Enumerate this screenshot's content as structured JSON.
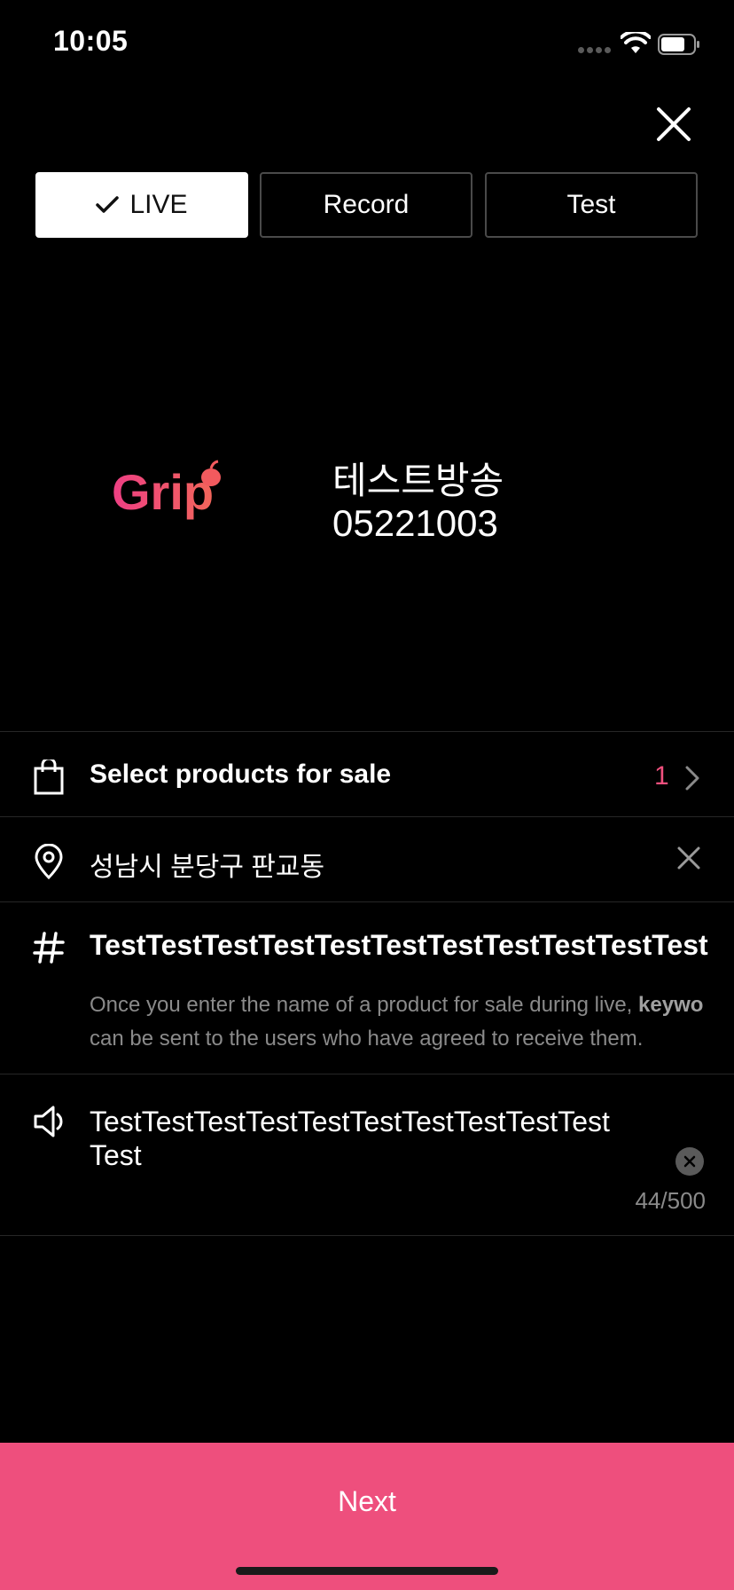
{
  "status_bar": {
    "time": "10:05"
  },
  "modes": [
    {
      "label": "LIVE",
      "active": true
    },
    {
      "label": "Record",
      "active": false
    },
    {
      "label": "Test",
      "active": false
    }
  ],
  "broadcast": {
    "logo_text": "Grip",
    "title_line1": "테스트방송",
    "title_line2": "05221003"
  },
  "products": {
    "label": "Select products for sale",
    "count": "1"
  },
  "location": {
    "value": "성남시 분당구 판교동"
  },
  "hashtags": {
    "value": "TestTestTestTestTestTestTestTestTestTestTest",
    "hint_part1": "Once you enter the name of a product for sale during live, ",
    "hint_bold": "keywo",
    "hint_part2": "can be sent to the users who have agreed to receive them."
  },
  "notice": {
    "line1": "TestTestTestTestTestTestTestTestTestTest",
    "line2": "Test",
    "counter": "44/500"
  },
  "next_button": {
    "label": "Next"
  },
  "colors": {
    "accent": "#ee4f7d",
    "background": "#000000"
  }
}
